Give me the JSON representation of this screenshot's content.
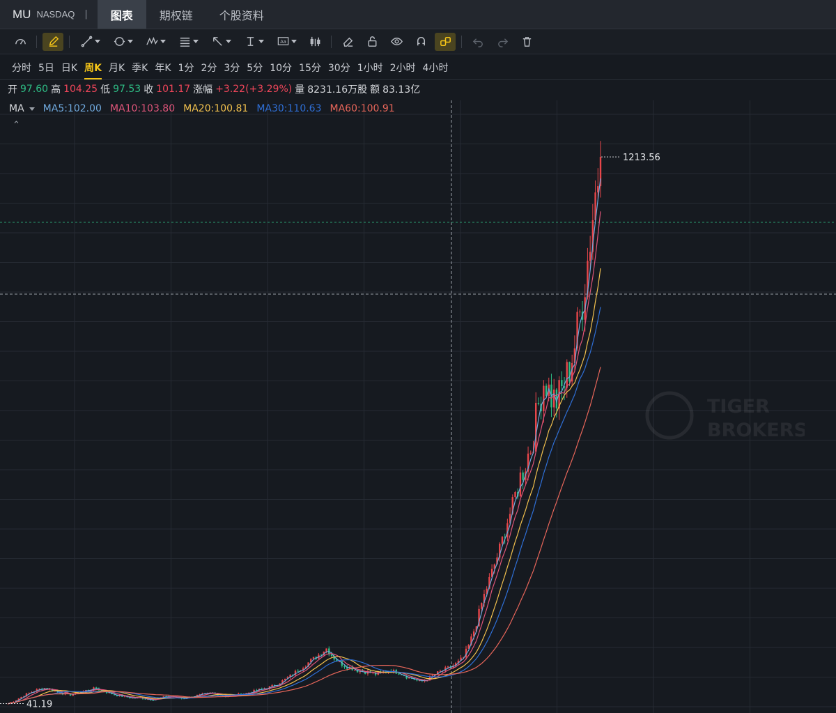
{
  "header": {
    "symbol": "MU",
    "exchange": "NASDAQ",
    "separator": "|",
    "tabs": [
      {
        "label": "图表",
        "active": true
      },
      {
        "label": "期权链",
        "active": false
      },
      {
        "label": "个股资料",
        "active": false
      }
    ]
  },
  "toolbar": {
    "icons": [
      "indicator-gauge-icon",
      "draw-pen-icon",
      "line-tool-icon",
      "circle-tool-icon",
      "pattern-tool-icon",
      "fib-tool-icon",
      "arrow-tool-icon",
      "text-cursor-icon",
      "text-box-icon",
      "bar-style-icon",
      "eraser-icon",
      "lock-icon",
      "eye-icon",
      "magnet-icon",
      "link-icon",
      "undo-icon",
      "redo-icon",
      "trash-icon"
    ]
  },
  "periods": {
    "items": [
      "分时",
      "5日",
      "日K",
      "周K",
      "月K",
      "季K",
      "年K",
      "1分",
      "2分",
      "3分",
      "5分",
      "10分",
      "15分",
      "30分",
      "1小时",
      "2小时",
      "4小时"
    ],
    "active_index": 3
  },
  "quote": {
    "open_label": "开",
    "open": "97.60",
    "high_label": "高",
    "high": "104.25",
    "low_label": "低",
    "low": "97.53",
    "close_label": "收",
    "close": "101.17",
    "change_label": "涨幅",
    "change": "+3.22(+3.29%)",
    "volume_label": "量",
    "volume": "8231.16万股",
    "amount_label": "额",
    "amount": "83.13亿"
  },
  "ma_legend": {
    "label": "MA",
    "items": [
      {
        "text": "MA5:102.00",
        "color": "#6fa8dc"
      },
      {
        "text": "MA10:103.80",
        "color": "#e0557a"
      },
      {
        "text": "MA20:100.81",
        "color": "#f2c14e"
      },
      {
        "text": "MA30:110.63",
        "color": "#2f6fd6"
      },
      {
        "text": "MA60:100.91",
        "color": "#e8665a"
      }
    ]
  },
  "chart_data": {
    "type": "candlestick",
    "period": "周K",
    "annotations": {
      "max_label": "1213.56",
      "min_label": "41.19"
    },
    "colors": {
      "up": "#e8464a",
      "down": "#2ebd85",
      "grid": "#262b33",
      "crosshair": "#9aa0a8",
      "dashed_level": "#2ebd85"
    },
    "y_domain": [
      30,
      1260
    ],
    "max_value": 1213.56,
    "min_value": 41.19,
    "price_path_weekly": [
      41.19,
      47,
      55,
      62,
      68,
      72,
      75,
      70,
      66,
      62,
      60,
      64,
      68,
      71,
      74,
      69,
      65,
      60,
      58,
      55,
      53,
      54,
      52,
      50,
      52,
      55,
      57,
      54,
      52,
      55,
      58,
      60,
      62,
      64,
      60,
      57,
      58,
      61,
      63,
      66,
      70,
      73,
      77,
      82,
      90,
      98,
      108,
      118,
      128,
      138,
      148,
      160,
      142,
      130,
      122,
      118,
      112,
      110,
      108,
      104,
      108,
      112,
      110,
      106,
      98,
      94,
      88,
      92,
      100,
      108,
      114,
      120,
      128,
      140,
      170,
      210,
      260,
      300,
      340,
      380,
      430,
      470,
      520,
      560,
      600,
      680,
      740,
      700,
      690,
      720,
      760,
      820,
      900,
      1000,
      1120,
      1213.56
    ]
  },
  "watermark": {
    "line1": "TIGER",
    "line2": "BROKERS"
  }
}
